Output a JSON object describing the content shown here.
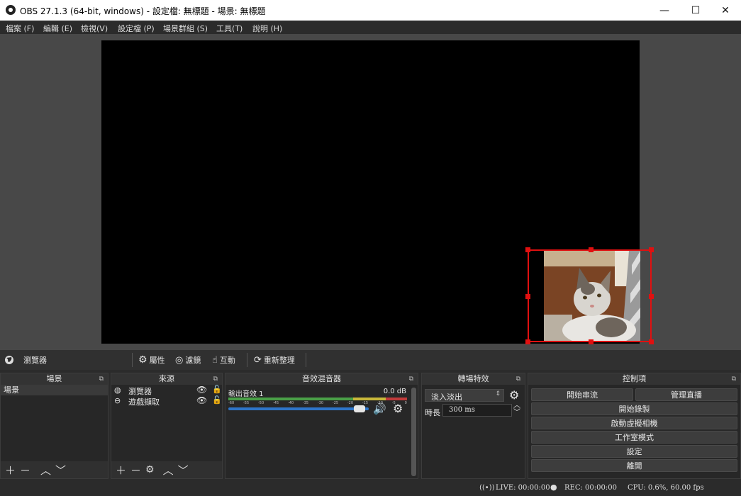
{
  "window": {
    "title": "OBS 27.1.3 (64-bit, windows) - 設定檔: 無標題 - 場景: 無標題",
    "minimize": "—",
    "maximize": "☐",
    "close": "✕"
  },
  "menu": [
    "檔案 (F)",
    "編輯 (E)",
    "檢視(V)",
    "設定檔 (P)",
    "場景群組 (S)",
    "工具(T)",
    "說明 (H)"
  ],
  "source_toolbar": {
    "current_source": "瀏覽器",
    "properties": "屬性",
    "filters": "濾鏡",
    "interact": "互動",
    "refresh": "重新整理"
  },
  "scenes": {
    "title": "場景",
    "items": [
      "場景"
    ]
  },
  "sources": {
    "title": "來源",
    "items": [
      "瀏覽器",
      "遊戲擷取"
    ]
  },
  "mixer": {
    "title": "音效混音器",
    "track_name": "輸出音效 1",
    "level": "0.0 dB",
    "ticks": [
      "-60",
      "-55",
      "-50",
      "-45",
      "-40",
      "-35",
      "-30",
      "-25",
      "-20",
      "-15",
      "-10",
      "-5",
      "0"
    ],
    "volume_fraction": 0.97
  },
  "transitions": {
    "title": "轉場特效",
    "selected": "淡入淡出",
    "duration_label": "時長",
    "duration_value": "300 ms"
  },
  "controls": {
    "title": "控制項",
    "start_streaming": "開始串流",
    "manage_broadcast": "管理直播",
    "start_recording": "開始錄製",
    "start_virtual_cam": "啟動虛擬相機",
    "studio_mode": "工作室模式",
    "settings": "設定",
    "exit": "離開"
  },
  "status": {
    "live": "LIVE: 00:00:00",
    "rec": "REC: 00:00:00",
    "cpu": "CPU: 0.6%, 60.00 fps"
  },
  "colors": {
    "accent": "#2e75c8",
    "selection": "#e01010"
  }
}
